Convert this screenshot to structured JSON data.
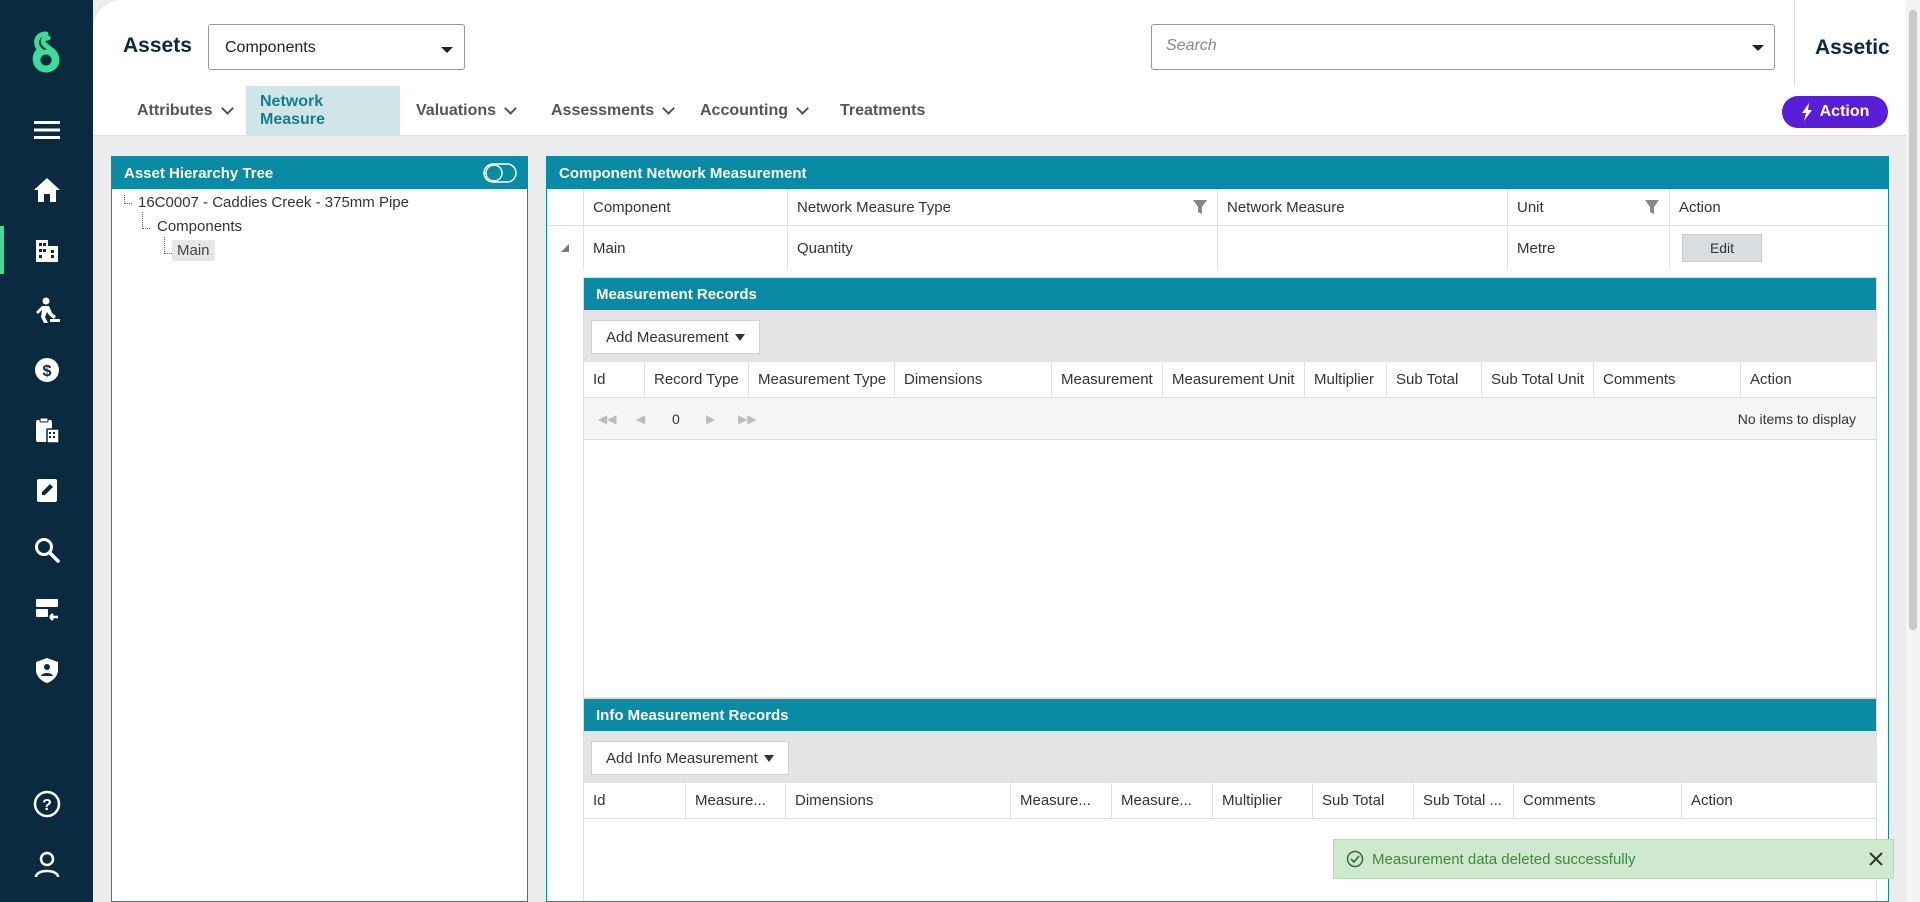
{
  "header": {
    "title": "Assets",
    "selector_value": "Components",
    "search_placeholder": "Search",
    "brand": "Assetic"
  },
  "sidebar": {
    "items": [
      {
        "icon": "menu-icon"
      },
      {
        "icon": "home-icon"
      },
      {
        "icon": "buildings-icon"
      },
      {
        "icon": "worker-icon"
      },
      {
        "icon": "finance-icon"
      },
      {
        "icon": "clipboard-calculator-icon"
      },
      {
        "icon": "edit-document-icon"
      },
      {
        "icon": "search-icon"
      },
      {
        "icon": "import-icon"
      },
      {
        "icon": "shield-user-icon"
      },
      {
        "icon": "help-icon"
      },
      {
        "icon": "user-icon"
      }
    ]
  },
  "tabs": [
    {
      "label": "Attributes"
    },
    {
      "label": "Network Measure"
    },
    {
      "label": "Valuations"
    },
    {
      "label": "Assessments"
    },
    {
      "label": "Accounting"
    },
    {
      "label": "Treatments"
    }
  ],
  "action_button": "Action",
  "tree": {
    "title": "Asset Hierarchy Tree",
    "root": "16C0007 - Caddies Creek - 375mm Pipe",
    "child": "Components",
    "leaf": "Main"
  },
  "component_grid": {
    "title": "Component Network Measurement",
    "columns": [
      "Component",
      "Network Measure Type",
      "Network Measure",
      "Unit",
      "Action"
    ],
    "row": {
      "component": "Main",
      "type": "Quantity",
      "measure": "",
      "unit": "Metre",
      "action": "Edit"
    }
  },
  "measurement_records": {
    "title": "Measurement Records",
    "add_button": "Add Measurement",
    "columns": [
      "Id",
      "Record Type",
      "Measurement Type",
      "Dimensions",
      "Measurement",
      "Measurement Unit",
      "Multiplier",
      "Sub Total",
      "Sub Total Unit",
      "Comments",
      "Action"
    ],
    "page": "0",
    "empty_text": "No items to display"
  },
  "info_records": {
    "title": "Info Measurement Records",
    "add_button": "Add Info Measurement",
    "columns": [
      "Id",
      "Measure...",
      "Dimensions",
      "Measure...",
      "Measure...",
      "Multiplier",
      "Sub Total",
      "Sub Total ...",
      "Comments",
      "Action"
    ]
  },
  "toast": {
    "message": "Measurement data deleted successfully"
  },
  "colors": {
    "sidebar": "#0a2a40",
    "accent": "#3ddc97",
    "panel_header": "#0a8ba5",
    "action_button": "#5a1ed8",
    "toast_bg": "#cfe9cf"
  }
}
